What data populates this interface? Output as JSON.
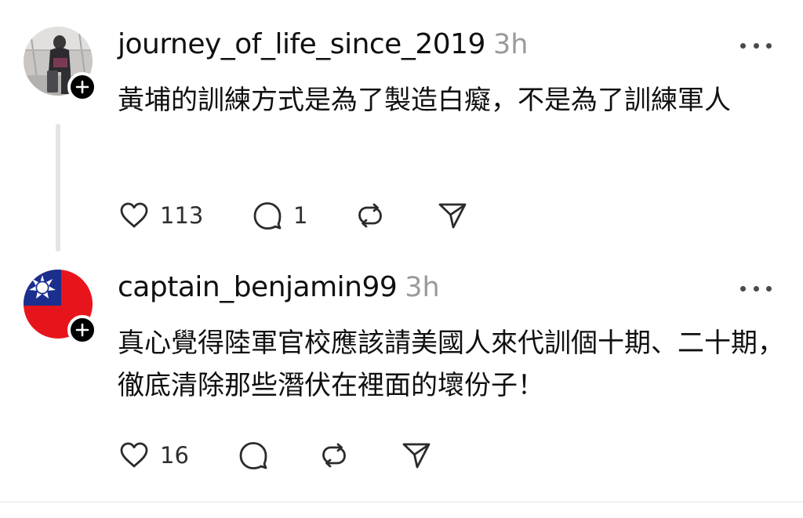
{
  "posts": [
    {
      "username": "journey_of_life_since_2019",
      "time": "3h",
      "text": "黃埔的訓練方式是為了製造白癡，不是為了訓練軍人",
      "avatar_icon": "traveler-photo-avatar",
      "likes": "113",
      "replies": "1"
    },
    {
      "username": "captain_benjamin99",
      "time": "3h",
      "text": "真心覺得陸軍官校應該請美國人來代訓個十期、二十期，徹底清除那些潛伏在裡面的壞份子！",
      "avatar_icon": "roc-flag-avatar",
      "likes": "16",
      "replies": ""
    }
  ],
  "icons": {
    "like": "heart-icon",
    "reply": "comment-icon",
    "repost": "repost-icon",
    "share": "send-icon",
    "more": "more-icon",
    "follow": "plus-icon"
  },
  "colors": {
    "text": "#101010",
    "muted": "#9a9a9a",
    "flag_red": "#e8141c",
    "flag_blue": "#1b2f8e"
  }
}
